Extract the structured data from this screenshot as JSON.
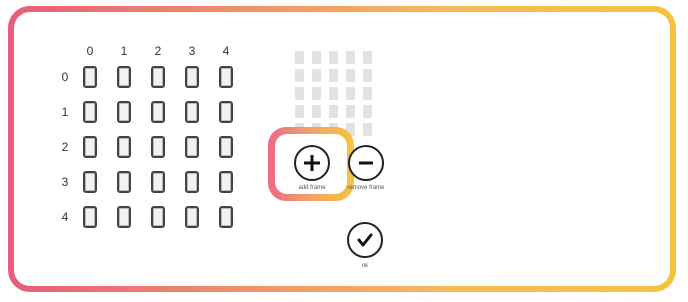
{
  "grid": {
    "columns": [
      "0",
      "1",
      "2",
      "3",
      "4"
    ],
    "rows": [
      "0",
      "1",
      "2",
      "3",
      "4"
    ]
  },
  "controls": {
    "add_frame_label": "add frame",
    "remove_frame_label": "remove frame",
    "ok_label": "ok",
    "add_icon": "plus-icon",
    "remove_icon": "minus-icon",
    "ok_icon": "checkmark-icon"
  },
  "colors": {
    "frame_gradient_start": "#e85c7a",
    "frame_gradient_end": "#f5c23f"
  }
}
